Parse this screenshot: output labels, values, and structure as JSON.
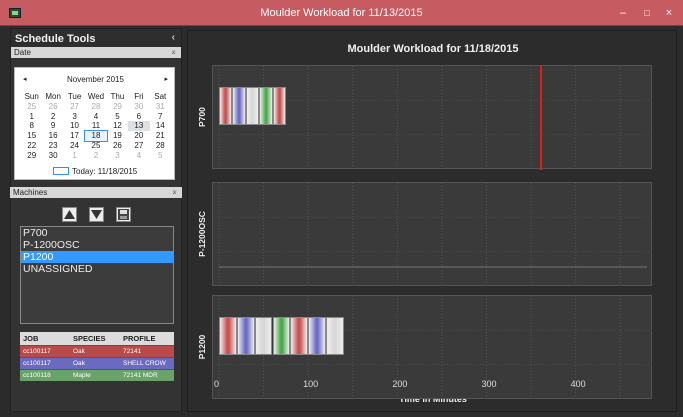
{
  "window": {
    "title": "Moulder Workload for 11/13/2015",
    "min": "–",
    "max": "□",
    "close": "×"
  },
  "sidebar": {
    "title": "Schedule Tools",
    "collapse": "‹",
    "date_section": "Date",
    "machines_section": "Machines",
    "pin": "⌅"
  },
  "calendar": {
    "month": "November 2015",
    "prev": "◂",
    "next": "▸",
    "weekdays": [
      "Sun",
      "Mon",
      "Tue",
      "Wed",
      "Thu",
      "Fri",
      "Sat"
    ],
    "weeks": [
      [
        "25",
        "26",
        "27",
        "28",
        "29",
        "30",
        "31"
      ],
      [
        "1",
        "2",
        "3",
        "4",
        "5",
        "6",
        "7"
      ],
      [
        "8",
        "9",
        "10",
        "11",
        "12",
        "13",
        "14"
      ],
      [
        "15",
        "16",
        "17",
        "18",
        "19",
        "20",
        "21"
      ],
      [
        "22",
        "23",
        "24",
        "25",
        "26",
        "27",
        "28"
      ],
      [
        "29",
        "30",
        "1",
        "2",
        "3",
        "4",
        "5"
      ]
    ],
    "today_label": "Today: 11/18/2015"
  },
  "machines": {
    "items": [
      "P700",
      "P-1200OSC",
      "P1200",
      "UNASSIGNED"
    ],
    "selected_index": 2,
    "move_up_icon": "triangle-up-icon",
    "move_down_icon": "triangle-down-icon",
    "save_icon": "floppy-save-icon"
  },
  "jobs": {
    "headers": [
      "JOB",
      "SPECIES",
      "PROFILE"
    ],
    "rows": [
      {
        "job": "cc100117",
        "species": "Oak",
        "profile": "72141",
        "color": "#b84a4a"
      },
      {
        "job": "cc100117",
        "species": "Oak",
        "profile": "SHELL CROW",
        "color": "#6a6ac0"
      },
      {
        "job": "cc100118",
        "species": "Maple",
        "profile": "72141 MDR",
        "color": "#6aa36a"
      }
    ]
  },
  "chart_data": {
    "type": "bar",
    "title": "Moulder Workload for 11/18/2015",
    "xlabel": "Time in Minutes",
    "xlim": [
      0,
      480
    ],
    "xticks": [
      "0",
      "100",
      "200",
      "300",
      "400"
    ],
    "grid": true,
    "limit_line_minutes": 360,
    "limit_line_color": "#e21b1b",
    "series": [
      {
        "name": "P700",
        "jobs": [
          {
            "start": 0,
            "end": 15,
            "color": "#c85050"
          },
          {
            "start": 15,
            "end": 30,
            "color": "#6b6bc8"
          },
          {
            "start": 30,
            "end": 45,
            "color": "#d8d8d8"
          },
          {
            "start": 45,
            "end": 60,
            "color": "#4caa4c"
          },
          {
            "start": 60,
            "end": 75,
            "color": "#c85050"
          }
        ]
      },
      {
        "name": "P-1200OSC",
        "jobs": []
      },
      {
        "name": "P1200",
        "jobs": [
          {
            "start": 0,
            "end": 20,
            "color": "#c85050"
          },
          {
            "start": 20,
            "end": 40,
            "color": "#6b6bc8"
          },
          {
            "start": 40,
            "end": 60,
            "color": "#d8d8d8"
          },
          {
            "start": 60,
            "end": 80,
            "color": "#4caa4c"
          },
          {
            "start": 80,
            "end": 100,
            "color": "#c85050"
          },
          {
            "start": 100,
            "end": 120,
            "color": "#6b6bc8"
          },
          {
            "start": 120,
            "end": 140,
            "color": "#d8d8d8"
          }
        ]
      }
    ]
  }
}
